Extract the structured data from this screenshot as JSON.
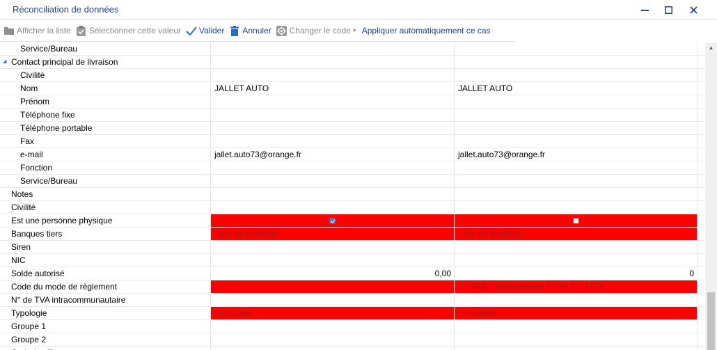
{
  "window": {
    "title": "Réconciliation de données",
    "controls": {
      "minimize": "—",
      "maximize": "☐",
      "close": "✕"
    }
  },
  "toolbar": {
    "afficher_liste": "Afficher la liste",
    "selectionner_valeur": "Sélectionner cette valeur",
    "valider": "Valider",
    "annuler": "Annuler",
    "changer_code": "Changer le code",
    "appliquer_auto": "Appliquer automatiquement ce cas",
    "icons": [
      "folder-icon",
      "clipboard-check-icon",
      "checkmark-icon",
      "trash-icon",
      "gear-icon"
    ]
  },
  "rows": [
    {
      "label": "Service/Bureau",
      "indent": 2,
      "v1": "",
      "v2": ""
    },
    {
      "label": "Contact principal de livraison",
      "indent": 1,
      "group": true,
      "v1": "",
      "v2": ""
    },
    {
      "label": "Civilité",
      "indent": 2,
      "v1": "",
      "v2": ""
    },
    {
      "label": "Nom",
      "indent": 2,
      "v1": "JALLET AUTO",
      "v2": "JALLET AUTO"
    },
    {
      "label": "Prénom",
      "indent": 2,
      "v1": "",
      "v2": ""
    },
    {
      "label": "Téléphone fixe",
      "indent": 2,
      "v1": "",
      "v2": ""
    },
    {
      "label": "Téléphone portable",
      "indent": 2,
      "v1": "",
      "v2": ""
    },
    {
      "label": "Fax",
      "indent": 2,
      "v1": "",
      "v2": ""
    },
    {
      "label": "e-mail",
      "indent": 2,
      "v1": "jallet.auto73@orange.fr",
      "v2": "jallet.auto73@orange.fr"
    },
    {
      "label": "Fonction",
      "indent": 2,
      "v1": "",
      "v2": ""
    },
    {
      "label": "Service/Bureau",
      "indent": 2,
      "v1": "",
      "v2": ""
    },
    {
      "label": "Notes",
      "indent": 1,
      "v1": "",
      "v2": ""
    },
    {
      "label": "Civilité",
      "indent": 1,
      "v1": "",
      "v2": ""
    },
    {
      "label": "Est une personne physique",
      "indent": 1,
      "conflict": true,
      "checkbox": true,
      "v1": true,
      "v2": false
    },
    {
      "label": "Banques tiers",
      "indent": 1,
      "conflict": true,
      "v1": "Liste de données",
      "v2": "Liste de données"
    },
    {
      "label": "Siren",
      "indent": 1,
      "v1": "",
      "v2": ""
    },
    {
      "label": "NIC",
      "indent": 1,
      "v1": "",
      "v2": ""
    },
    {
      "label": "Solde autorisé",
      "indent": 1,
      "numeric": true,
      "v1": "0,00",
      "v2": "0"
    },
    {
      "label": "Code du mode de règlement",
      "indent": 1,
      "conflict": true,
      "v1": "",
      "v2": "SEPA30 - Prélèvement SEPA 30J FDM"
    },
    {
      "label": "N° de TVA intracommunautaire",
      "indent": 1,
      "v1": "",
      "v2": ""
    },
    {
      "label": "Typologie",
      "indent": 1,
      "conflict": true,
      "v1": "Particulier",
      "v2": "Entreprise"
    },
    {
      "label": "Groupe 1",
      "indent": 1,
      "v1": "",
      "v2": ""
    },
    {
      "label": "Groupe 2",
      "indent": 1,
      "v1": "",
      "v2": ""
    },
    {
      "label": "Code famille",
      "indent": 1,
      "v1": "",
      "v2": ""
    }
  ],
  "colors": {
    "conflict": "#ff0000",
    "accent": "#1f3f8f"
  }
}
